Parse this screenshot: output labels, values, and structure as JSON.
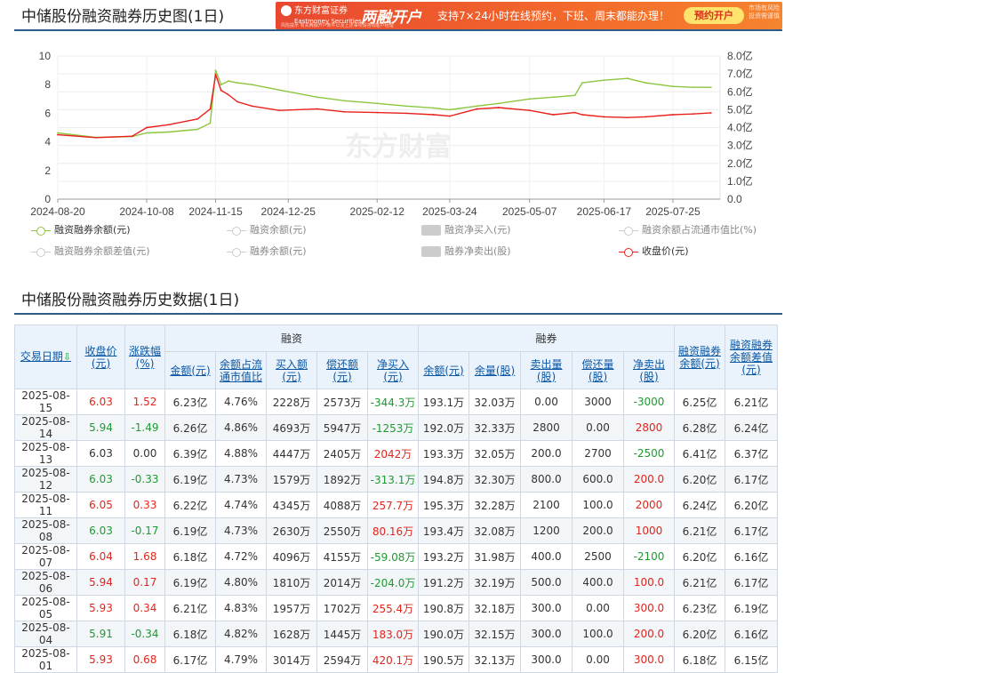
{
  "chart_section": {
    "title": "中储股份融资融券历史图(1日)"
  },
  "banner": {
    "logo_line1": "东方财富证券",
    "logo_line2": "Eastmoney Securities",
    "main": "两融开户",
    "desc": "支持7×24小时在线预约，下班、周末都能办理！",
    "button": "预约开户",
    "side": "市场有风险 投资需谨慎",
    "tiny": "风险提示 有关两融开户条件以及上述事项请咨询客户经理"
  },
  "watermark": "东方财富",
  "chart_data": {
    "type": "line",
    "x_tick_labels": [
      "2024-08-20",
      "2024-10-08",
      "2024-11-15",
      "2024-12-25",
      "2025-02-12",
      "2025-03-24",
      "2025-05-07",
      "2025-06-17",
      "2025-07-25"
    ],
    "left_axis": {
      "ylim": [
        0,
        10
      ],
      "ticks": [
        "0",
        "2",
        "4",
        "6",
        "8",
        "10"
      ]
    },
    "right_axis": {
      "ylim": [
        0,
        8
      ],
      "ticks": [
        "0.0",
        "1.0亿",
        "2.0亿",
        "3.0亿",
        "4.0亿",
        "5.0亿",
        "6.0亿",
        "7.0亿",
        "8.0亿"
      ]
    },
    "grid": true,
    "series": [
      {
        "name": "融资融券余额(元)",
        "axis": "right",
        "color": "#8cc63f",
        "x": [
          "2024-08-20",
          "2024-09-10",
          "2024-09-30",
          "2024-10-08",
          "2024-10-20",
          "2024-11-05",
          "2024-11-12",
          "2024-11-15",
          "2024-11-18",
          "2024-11-22",
          "2024-11-27",
          "2024-12-05",
          "2024-12-20",
          "2025-01-10",
          "2025-01-25",
          "2025-02-12",
          "2025-02-28",
          "2025-03-15",
          "2025-03-24",
          "2025-04-08",
          "2025-04-20",
          "2025-05-07",
          "2025-05-20",
          "2025-06-01",
          "2025-06-05",
          "2025-06-17",
          "2025-06-30",
          "2025-07-10",
          "2025-07-25",
          "2025-08-05",
          "2025-08-15"
        ],
        "values": [
          3.7,
          3.45,
          3.5,
          3.7,
          3.75,
          3.9,
          4.25,
          7.2,
          6.4,
          6.6,
          6.5,
          6.4,
          6.1,
          5.7,
          5.5,
          5.35,
          5.2,
          5.1,
          5.0,
          5.2,
          5.35,
          5.6,
          5.7,
          5.8,
          6.5,
          6.65,
          6.75,
          6.5,
          6.3,
          6.25,
          6.25
        ]
      },
      {
        "name": "收盘价(元)",
        "axis": "left",
        "color": "#e8201c",
        "x": [
          "2024-08-20",
          "2024-09-10",
          "2024-09-30",
          "2024-10-08",
          "2024-10-20",
          "2024-11-05",
          "2024-11-12",
          "2024-11-15",
          "2024-11-18",
          "2024-11-22",
          "2024-11-27",
          "2024-12-05",
          "2024-12-20",
          "2025-01-10",
          "2025-01-25",
          "2025-02-12",
          "2025-02-28",
          "2025-03-15",
          "2025-03-24",
          "2025-04-08",
          "2025-04-20",
          "2025-05-07",
          "2025-05-20",
          "2025-06-01",
          "2025-06-05",
          "2025-06-17",
          "2025-06-30",
          "2025-07-10",
          "2025-07-25",
          "2025-08-05",
          "2025-08-15"
        ],
        "values": [
          4.5,
          4.3,
          4.4,
          5.0,
          5.2,
          5.6,
          6.3,
          8.7,
          7.6,
          7.3,
          6.8,
          6.5,
          6.2,
          6.3,
          6.1,
          6.05,
          6.0,
          5.9,
          5.8,
          6.3,
          6.4,
          6.2,
          5.9,
          6.05,
          5.9,
          5.75,
          5.7,
          5.75,
          5.9,
          5.95,
          6.03
        ]
      }
    ]
  },
  "legend": [
    {
      "label": "融资融券余额(元)",
      "color": "#8cc63f",
      "kind": "line",
      "active": true
    },
    {
      "label": "融资余额(元)",
      "color": "#cccccc",
      "kind": "line",
      "active": false
    },
    {
      "label": "融资净买入(元)",
      "color": "#cccccc",
      "kind": "box",
      "active": false
    },
    {
      "label": "融资余额占流通市值比(%)",
      "color": "#cccccc",
      "kind": "line",
      "active": false
    },
    {
      "label": "融资融券余额差值(元)",
      "color": "#cccccc",
      "kind": "line",
      "active": false
    },
    {
      "label": "融券余额(元)",
      "color": "#cccccc",
      "kind": "line",
      "active": false
    },
    {
      "label": "融券净卖出(股)",
      "color": "#cccccc",
      "kind": "box",
      "active": false
    },
    {
      "label": "收盘价(元)",
      "color": "#e8201c",
      "kind": "line",
      "active": true
    }
  ],
  "table_section": {
    "title": "中储股份融资融券历史数据(1日)"
  },
  "table": {
    "header": {
      "date": "交易日期",
      "date_arrow": "⇩",
      "close": "收盘价(元)",
      "change": "涨跌幅(%)",
      "rz_group": "融资",
      "rq_group": "融券",
      "rz_balance": "金额(元)",
      "rz_ratio": "余额占流通市值比",
      "rz_buy": "买入额(元)",
      "rz_repay": "偿还额(元)",
      "rz_net": "净买入(元)",
      "rq_balance": "余额(元)",
      "rq_volume": "余量(股)",
      "rq_sell": "卖出量(股)",
      "rq_repay": "偿还量(股)",
      "rq_net": "净卖出(股)",
      "total": "融资融券余额(元)",
      "diff": "融资融券余额差值(元)"
    },
    "rows": [
      [
        "2025-08-15",
        "6.03",
        "1.52",
        "6.23亿",
        "4.76%",
        "2228万",
        "2573万",
        "-344.3万",
        "193.1万",
        "32.03万",
        "0.00",
        "3000",
        "-3000",
        "6.25亿",
        "6.21亿"
      ],
      [
        "2025-08-14",
        "5.94",
        "-1.49",
        "6.26亿",
        "4.86%",
        "4693万",
        "5947万",
        "-1253万",
        "192.0万",
        "32.33万",
        "2800",
        "0.00",
        "2800",
        "6.28亿",
        "6.24亿"
      ],
      [
        "2025-08-13",
        "6.03",
        "0.00",
        "6.39亿",
        "4.88%",
        "4447万",
        "2405万",
        "2042万",
        "193.3万",
        "32.05万",
        "200.0",
        "2700",
        "-2500",
        "6.41亿",
        "6.37亿"
      ],
      [
        "2025-08-12",
        "6.03",
        "-0.33",
        "6.19亿",
        "4.73%",
        "1579万",
        "1892万",
        "-313.1万",
        "194.8万",
        "32.30万",
        "800.0",
        "600.0",
        "200.0",
        "6.20亿",
        "6.17亿"
      ],
      [
        "2025-08-11",
        "6.05",
        "0.33",
        "6.22亿",
        "4.74%",
        "4345万",
        "4088万",
        "257.7万",
        "195.3万",
        "32.28万",
        "2100",
        "100.0",
        "2000",
        "6.24亿",
        "6.20亿"
      ],
      [
        "2025-08-08",
        "6.03",
        "-0.17",
        "6.19亿",
        "4.73%",
        "2630万",
        "2550万",
        "80.16万",
        "193.4万",
        "32.08万",
        "1200",
        "200.0",
        "1000",
        "6.21亿",
        "6.17亿"
      ],
      [
        "2025-08-07",
        "6.04",
        "1.68",
        "6.18亿",
        "4.72%",
        "4096万",
        "4155万",
        "-59.08万",
        "193.2万",
        "31.98万",
        "400.0",
        "2500",
        "-2100",
        "6.20亿",
        "6.16亿"
      ],
      [
        "2025-08-06",
        "5.94",
        "0.17",
        "6.19亿",
        "4.80%",
        "1810万",
        "2014万",
        "-204.0万",
        "191.2万",
        "32.19万",
        "500.0",
        "400.0",
        "100.0",
        "6.21亿",
        "6.17亿"
      ],
      [
        "2025-08-05",
        "5.93",
        "0.34",
        "6.21亿",
        "4.83%",
        "1957万",
        "1702万",
        "255.4万",
        "190.8万",
        "32.18万",
        "300.0",
        "0.00",
        "300.0",
        "6.23亿",
        "6.19亿"
      ],
      [
        "2025-08-04",
        "5.91",
        "-0.34",
        "6.18亿",
        "4.82%",
        "1628万",
        "1445万",
        "183.0万",
        "190.0万",
        "32.15万",
        "300.0",
        "100.0",
        "200.0",
        "6.20亿",
        "6.16亿"
      ],
      [
        "2025-08-01",
        "5.93",
        "0.68",
        "6.17亿",
        "4.79%",
        "3014万",
        "2594万",
        "420.1万",
        "190.5万",
        "32.13万",
        "300.0",
        "0.00",
        "300.0",
        "6.18亿",
        "6.15亿"
      ]
    ]
  }
}
